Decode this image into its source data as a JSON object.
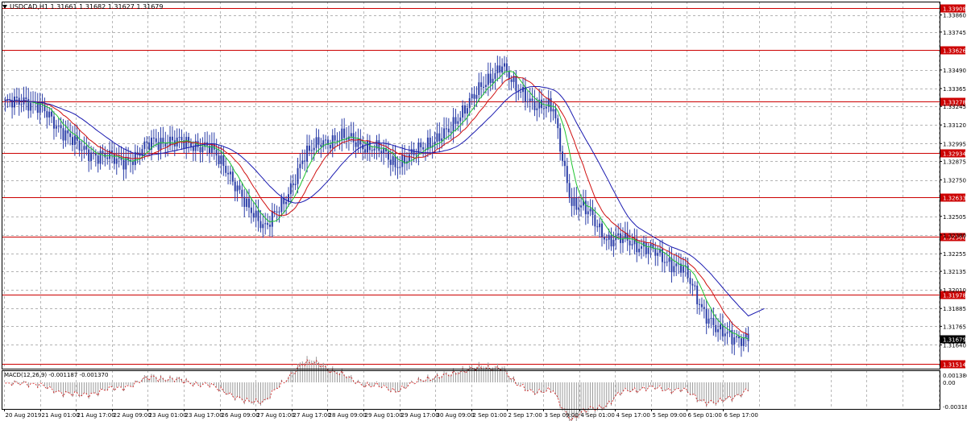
{
  "chart": {
    "symbol_label": "USDCAD,H1  1.31661 1.31682 1.31627 1.31679",
    "macd_label": "MACD(12,26,9) -0.001187 -0.001370",
    "current_price": "1.31679",
    "colors": {
      "background": "#ffffff",
      "grid": "#9a9a9a",
      "candle": "#2c3fa8",
      "level_line": "#cc0000",
      "ma_fast": "#21c431",
      "ma_mid": "#d01010",
      "ma_slow": "#1a1ab0",
      "macd_hist": "#9a9a9a",
      "macd_signal": "#d01010"
    }
  },
  "chart_data": {
    "type": "candlestick",
    "symbol": "USDCAD",
    "timeframe": "H1",
    "ohlc_header": {
      "open": 1.31661,
      "high": 1.31682,
      "low": 1.31627,
      "close": 1.31679
    },
    "price_axis_ticks": [
      "1.33860",
      "1.33745",
      "1.33490",
      "1.33365",
      "1.33245",
      "1.33120",
      "1.32995",
      "1.32875",
      "1.32750",
      "1.32505",
      "1.32380",
      "1.32255",
      "1.32135",
      "1.32010",
      "1.31885",
      "1.31765",
      "1.31640"
    ],
    "ylim": [
      1.3148,
      1.3395
    ],
    "horizontal_levels": [
      "1.33908",
      "1.33626",
      "1.33278",
      "1.32934",
      "1.32633",
      "1.32366",
      "1.31978",
      "1.31514"
    ],
    "time_axis_labels": [
      "20 Aug 2019",
      "21 Aug 01:00",
      "21 Aug 17:00",
      "22 Aug 09:00",
      "23 Aug 01:00",
      "23 Aug 17:00",
      "26 Aug 09:00",
      "27 Aug 01:00",
      "27 Aug 17:00",
      "28 Aug 09:00",
      "29 Aug 01:00",
      "29 Aug 17:00",
      "30 Aug 09:00",
      "2 Sep 01:00",
      "2 Sep 17:00",
      "3 Sep 09:00",
      "4 Sep 01:00",
      "4 Sep 17:00",
      "5 Sep 09:00",
      "6 Sep 01:00",
      "6 Sep 17:00"
    ],
    "price_anchors": [
      [
        0,
        1.3325
      ],
      [
        8,
        1.333
      ],
      [
        16,
        1.3322
      ],
      [
        24,
        1.331
      ],
      [
        32,
        1.3296
      ],
      [
        40,
        1.3292
      ],
      [
        48,
        1.3288
      ],
      [
        56,
        1.329
      ],
      [
        64,
        1.3302
      ],
      [
        72,
        1.33
      ],
      [
        80,
        1.33
      ],
      [
        88,
        1.3296
      ],
      [
        96,
        1.3282
      ],
      [
        104,
        1.3256
      ],
      [
        112,
        1.3245
      ],
      [
        120,
        1.3258
      ],
      [
        128,
        1.329
      ],
      [
        136,
        1.33
      ],
      [
        144,
        1.3304
      ],
      [
        152,
        1.33
      ],
      [
        160,
        1.3296
      ],
      [
        168,
        1.3286
      ],
      [
        176,
        1.3292
      ],
      [
        184,
        1.3302
      ],
      [
        192,
        1.3308
      ],
      [
        200,
        1.333
      ],
      [
        208,
        1.334
      ],
      [
        214,
        1.3355
      ],
      [
        220,
        1.3335
      ],
      [
        228,
        1.3327
      ],
      [
        236,
        1.3322
      ],
      [
        240,
        1.329
      ],
      [
        244,
        1.326
      ],
      [
        252,
        1.3252
      ],
      [
        260,
        1.3234
      ],
      [
        268,
        1.3235
      ],
      [
        276,
        1.3229
      ],
      [
        284,
        1.3222
      ],
      [
        292,
        1.3215
      ],
      [
        300,
        1.319
      ],
      [
        307,
        1.3172
      ],
      [
        314,
        1.317
      ],
      [
        320,
        1.3168
      ]
    ],
    "moving_averages": [
      "fast (green)",
      "mid (red)",
      "slow (blue)"
    ],
    "macd": {
      "value": -0.001187,
      "signal": -0.00137,
      "axis_ticks": [
        "0.001386",
        "0.00",
        "-0.003181"
      ]
    }
  }
}
